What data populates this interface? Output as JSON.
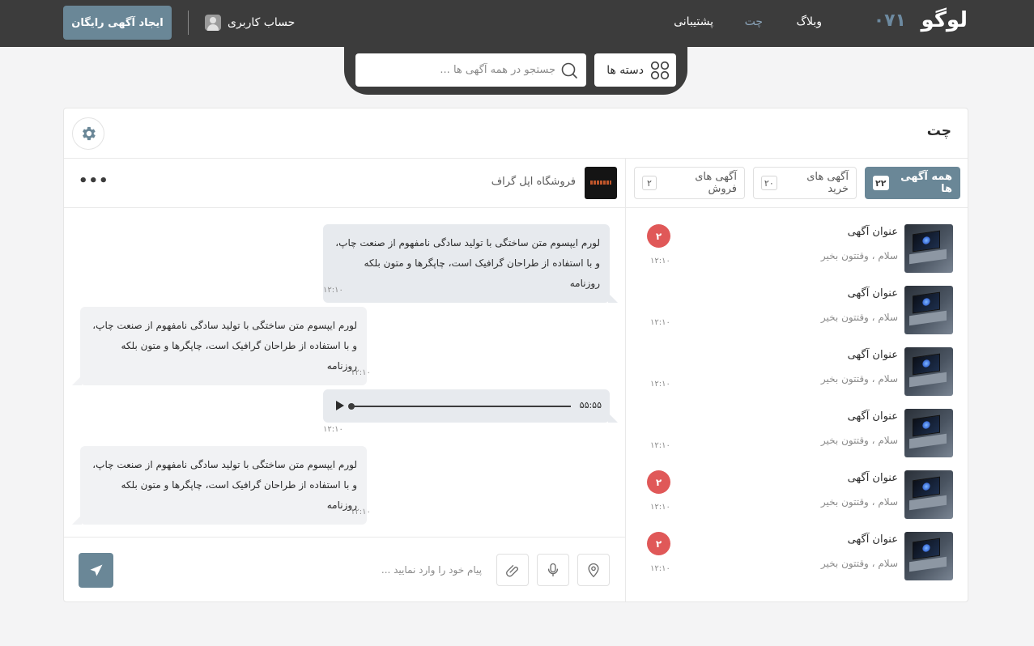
{
  "header": {
    "logo": "لوگو",
    "logo_number": "۰۷۱",
    "nav": {
      "blog": "وبلاگ",
      "chat": "چت",
      "support": "پشتیبانی"
    },
    "account": "حساب کاربری",
    "cta": "ایجاد آگهی رایگان",
    "search_placeholder": "جستجو در همه آگهی ها ...",
    "categories": "دسته ها"
  },
  "panel": {
    "title": "چت",
    "tabs": [
      {
        "label": "همه آگهی ها",
        "count": "۲۲"
      },
      {
        "label": "آگهی های خرید",
        "count": "۲۰"
      },
      {
        "label": "آگهی های فروش",
        "count": "۲"
      }
    ],
    "items": [
      {
        "title": "عنوان آگهی",
        "subtitle": "سلام ، وقتتون بخیر",
        "time": "۱۲:۱۰",
        "badge": "۲"
      },
      {
        "title": "عنوان آگهی",
        "subtitle": "سلام ، وقتتون بخیر",
        "time": "۱۲:۱۰",
        "badge": ""
      },
      {
        "title": "عنوان آگهی",
        "subtitle": "سلام ، وقتتون بخیر",
        "time": "۱۲:۱۰",
        "badge": ""
      },
      {
        "title": "عنوان آگهی",
        "subtitle": "سلام ، وقتتون بخیر",
        "time": "۱۲:۱۰",
        "badge": ""
      },
      {
        "title": "عنوان آگهی",
        "subtitle": "سلام ، وقتتون بخیر",
        "time": "۱۲:۱۰",
        "badge": "۲"
      },
      {
        "title": "عنوان آگهی",
        "subtitle": "سلام ، وقتتون بخیر",
        "time": "۱۲:۱۰",
        "badge": "۲"
      }
    ]
  },
  "chat": {
    "shop_name": "فروشگاه اپل گراف",
    "more": "•••",
    "messages": [
      {
        "line1": "لورم ایپسوم متن ساختگی با تولید سادگی نامفهوم از صنعت چاپ،",
        "line2": "و با استفاده از طراحان گرافیک است، چاپگرها و متون بلکه روزنامه",
        "time": "۱۲:۱۰"
      },
      {
        "line1": "لورم ایپسوم متن ساختگی با تولید سادگی نامفهوم از صنعت چاپ،",
        "line2": "و با استفاده از طراحان گرافیک است، چاپگرها و متون بلکه روزنامه",
        "time": "۱۲:۱۰"
      },
      {
        "audio_duration": "۵۵:۵۵",
        "audio_progress": 0,
        "time": "۱۲:۱۰"
      },
      {
        "line1": "لورم ایپسوم متن ساختگی با تولید سادگی نامفهوم از صنعت چاپ،",
        "line2": "و با استفاده از طراحان گرافیک است، چاپگرها و متون بلکه روزنامه",
        "time": "۱۲:۱۰"
      }
    ],
    "composer_placeholder": "پیام خود را وارد نمایید ..."
  },
  "colors": {
    "header_bg": "#3c3c3c",
    "accent": "#6a8797",
    "badge": "#e05858",
    "active_nav": "#8aa3b8"
  }
}
